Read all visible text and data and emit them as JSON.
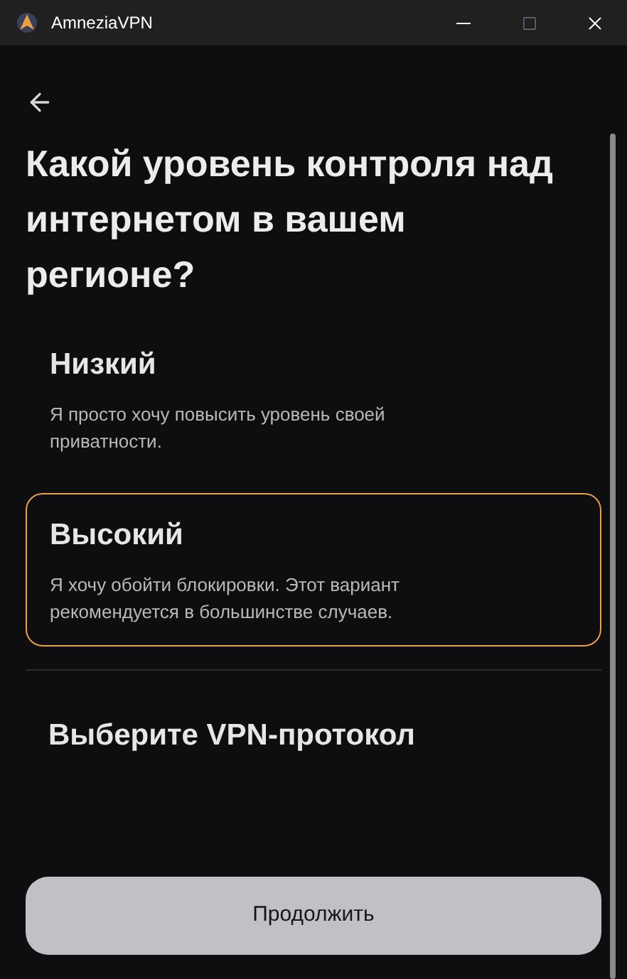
{
  "window": {
    "title": "AmneziaVPN"
  },
  "heading": "Какой уровень контроля над интернетом в вашем регионе?",
  "options": [
    {
      "title": "Низкий",
      "description": "Я просто хочу повысить уровень своей приватности.",
      "selected": false
    },
    {
      "title": "Высокий",
      "description": "Я хочу обойти блокировки. Этот вариант рекомендуется в большинстве случаев.",
      "selected": true
    }
  ],
  "protocol_link": "Выберите VPN-протокол",
  "continue_button": "Продолжить"
}
